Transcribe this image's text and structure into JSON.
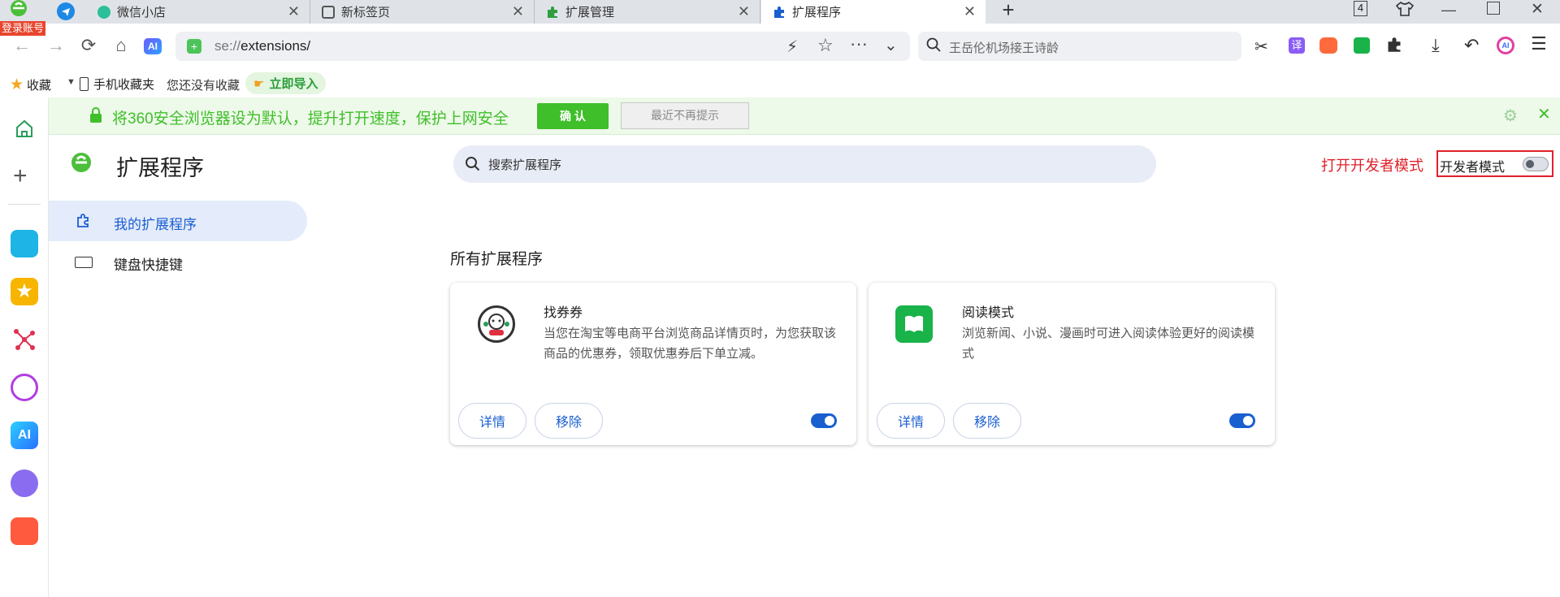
{
  "account": {
    "login_label": "登录账号"
  },
  "tabs": [
    {
      "label": "微信小店"
    },
    {
      "label": "新标签页"
    },
    {
      "label": "扩展管理"
    },
    {
      "label": "扩展程序"
    }
  ],
  "window": {
    "tab_count": "4"
  },
  "address": {
    "scheme": "se://",
    "path": "extensions/"
  },
  "search": {
    "placeholder": "王岳伦机场接王诗龄"
  },
  "toolbar": {
    "translate_label": "译",
    "ai_label": "AI"
  },
  "bookmarks": {
    "favorites_label": "收藏",
    "mobile_label": "手机收藏夹",
    "empty_label": "您还没有收藏",
    "import_label": "立即导入"
  },
  "banner": {
    "message": "将360安全浏览器设为默认，提升打开速度，保护上网安全",
    "confirm_label": "确 认",
    "dismiss_label": "最近不再提示"
  },
  "extensions_page": {
    "title": "扩展程序",
    "search_placeholder": "搜索扩展程序",
    "dev_mode_hint": "打开开发者模式",
    "dev_mode_label": "开发者模式",
    "dev_mode_enabled": false,
    "nav": [
      {
        "label": "我的扩展程序",
        "active": true
      },
      {
        "label": "键盘快捷键",
        "active": false
      }
    ],
    "section_title": "所有扩展程序",
    "cards": [
      {
        "name": "找券券",
        "description": "当您在淘宝等电商平台浏览商品详情页时，为您获取该商品的优惠券，领取优惠券后下单立减。",
        "details_label": "详情",
        "remove_label": "移除",
        "enabled": true
      },
      {
        "name": "阅读模式",
        "description": "浏览新闻、小说、漫画时可进入阅读体验更好的阅读模式",
        "details_label": "详情",
        "remove_label": "移除",
        "enabled": true
      }
    ]
  },
  "colors": {
    "accent": "#1a5fd0",
    "banner_green": "#3fbf2a",
    "dev_hint_red": "#e0202a"
  }
}
